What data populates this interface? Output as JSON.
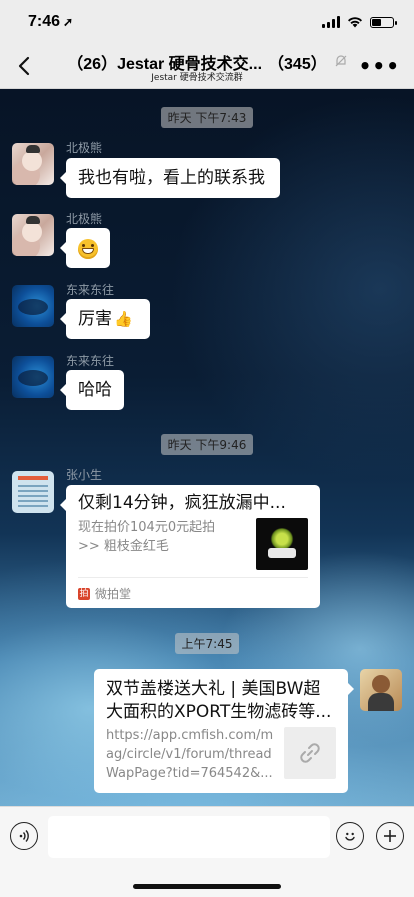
{
  "status_bar": {
    "time": "7:46",
    "time_arrow": "➚"
  },
  "nav": {
    "title": "（26）Jestar 硬骨技术交...",
    "member_count": "（345）",
    "subtitle": "Jestar 硬骨技术交流群",
    "back_icon": "chevron-left-icon",
    "mute_icon": "mute-bell-icon",
    "more_label": "•••"
  },
  "chat": {
    "timestamps": [
      "昨天 下午7:43",
      "昨天 下午9:46",
      "上午7:45"
    ],
    "messages": [
      {
        "sender": "北极熊",
        "text": "我也有啦，看上的联系我"
      },
      {
        "sender": "北极熊",
        "text": "",
        "emoji": "grin-emoji"
      },
      {
        "sender": "东来东往",
        "text": "厉害",
        "emoji": "thumbs-up-emoji"
      },
      {
        "sender": "东来东往",
        "text": "哈哈"
      }
    ],
    "auction_card": {
      "sender": "张小生",
      "title": "仅剩14分钟，疯狂放漏中...",
      "desc_line1": "现在拍价104元0元起拍",
      "desc_line2": ">> 粗枝金红毛",
      "source": "微拍堂",
      "source_icon_char": "拍"
    },
    "link_card": {
      "title_line1": "双节盖楼送大礼 | 美国BW超",
      "title_line2": "大面积的XPORT生物滤砖等...",
      "url_line1": "https://app.cmfish.com/m",
      "url_line2": "ag/circle/v1/forum/thread",
      "url_line3": "WapPage?tid=764542&..."
    }
  },
  "input_bar": {
    "voice_icon": "voice-icon",
    "emoji_icon": "emoji-icon",
    "plus_icon": "plus-icon",
    "text_value": ""
  }
}
